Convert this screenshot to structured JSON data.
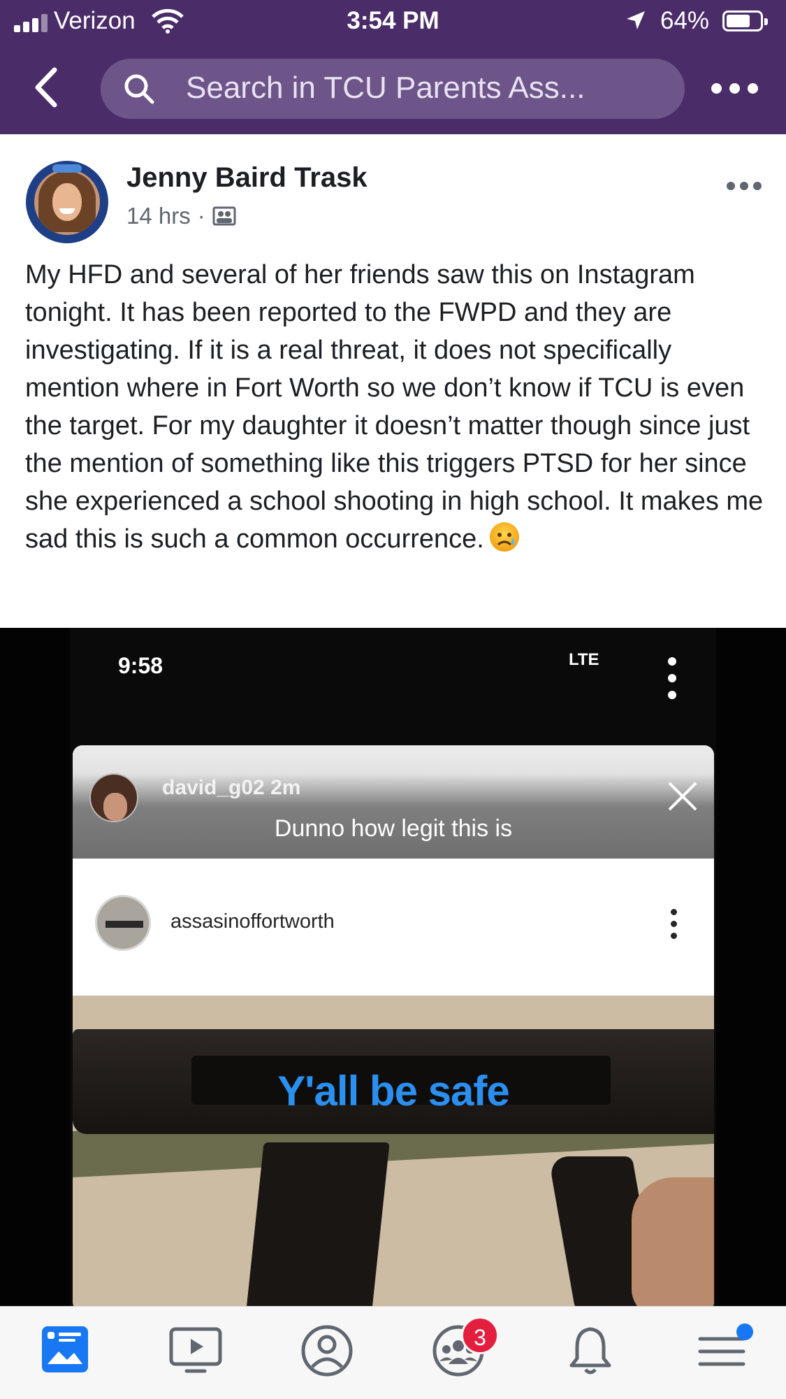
{
  "status_bar": {
    "carrier": "Verizon",
    "time": "3:54 PM",
    "battery": "64%"
  },
  "header": {
    "search_placeholder": "Search in TCU Parents Ass..."
  },
  "post": {
    "author": "Jenny Baird Trask",
    "time": "14 hrs",
    "separator": "·",
    "text": "My HFD and several of her friends saw this on Instagram tonight. It has been reported to the FWPD and they are investigating. If it is a real threat, it does not specifically mention where in Fort Worth so we don’t know if TCU is even the target. For my daughter it doesn’t matter though since just the mention of something like this triggers PTSD for her since she experienced a school shooting in high school. It makes me sad this is such a common occurrence.",
    "emoji": "sad-face-emoji"
  },
  "photo": {
    "phone_time": "9:58",
    "phone_network": "LTE",
    "dm_username": "david_g02 2m",
    "dm_message": "Dunno how legit this is",
    "ig_username": "assasinoffortworth",
    "overlay_text": "Y'all be safe",
    "overlay_color": "#2b8ff0"
  },
  "tabbar": {
    "tabs": [
      "news-feed",
      "watch",
      "profile",
      "groups",
      "notifications",
      "menu"
    ],
    "groups_badge": "3",
    "active_color": "#1877f2"
  },
  "colors": {
    "header_bg": "#4a2c69",
    "search_bg": "#6d5589"
  }
}
